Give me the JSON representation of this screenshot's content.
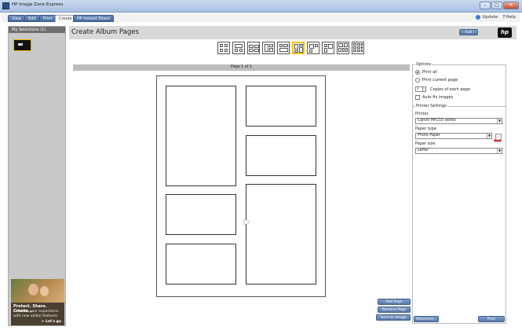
{
  "window": {
    "title": "HP Image Zone Express"
  },
  "tabs": [
    {
      "label": "View",
      "active": false
    },
    {
      "label": "Edit",
      "active": false
    },
    {
      "label": "Print",
      "active": false
    },
    {
      "label": "Create",
      "active": true
    },
    {
      "label": "HP Instant Share",
      "active": false
    }
  ],
  "topright": {
    "update_label": "Update",
    "help_label": "Help"
  },
  "sidebar": {
    "header": "My Selections (1)",
    "promo": {
      "title": "Protect. Share. Create...",
      "subtitle": "Enhance your experience with new addon features.",
      "link": "> Let's go"
    }
  },
  "main": {
    "title": "Create Album Pages",
    "exit_label": "Exit",
    "logo_text": "hp",
    "page_indicator": "Page 1 of 1",
    "selected_layout_index": 5
  },
  "actions": {
    "add_page": "Add Page",
    "remove_page": "Remove Page",
    "save_as_image": "Save as Image"
  },
  "options": {
    "legend": "Options",
    "print_all": "Print all",
    "print_current": "Print current page",
    "copies_value": "1",
    "copies_label": "Copies of each page",
    "auto_fix": "Auto fix images"
  },
  "printer_settings": {
    "legend": "Printer Settings",
    "printer_label": "Printer",
    "printer_value": "Canon MP210 series",
    "paper_type_label": "Paper type",
    "paper_type_value": "Photo Paper",
    "paper_size_label": "Paper size",
    "paper_size_value": "Letter",
    "advanced_label": "Advanced...",
    "print_label": "Print"
  },
  "colors": {
    "accent_button": "#5879a8",
    "selected_layout": "#f2c200",
    "titlebar": "#a9c1e2"
  }
}
